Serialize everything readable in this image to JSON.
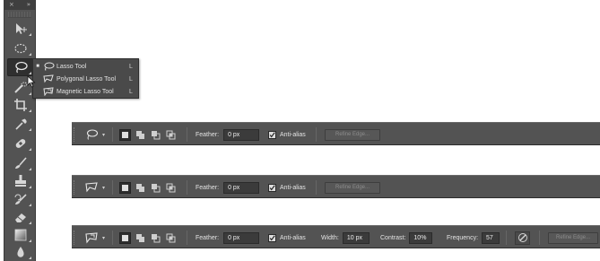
{
  "panel_header": {
    "collapse": "×",
    "expand": "»"
  },
  "flyout": {
    "items": [
      {
        "bullet": "■",
        "label": "Lasso Tool",
        "shortcut": "L",
        "icon": "lasso-icon"
      },
      {
        "bullet": "",
        "label": "Polygonal Lasso Tool",
        "shortcut": "L",
        "icon": "polygonal-lasso-icon"
      },
      {
        "bullet": "",
        "label": "Magnetic Lasso Tool",
        "shortcut": "L",
        "icon": "magnetic-lasso-icon"
      }
    ]
  },
  "tools": [
    "move-tool-icon",
    "elliptical-marquee-icon",
    "lasso-tool-icon",
    "quick-selection-icon",
    "crop-tool-icon",
    "eyedropper-icon",
    "healing-brush-icon",
    "brush-tool-icon",
    "clone-stamp-icon",
    "history-brush-icon",
    "eraser-icon",
    "gradient-icon",
    "blur-tool-icon"
  ],
  "options_bars": [
    {
      "tool_icon": "lasso-icon",
      "feather_label": "Feather:",
      "feather_value": "0 px",
      "antialias_label": "Anti-alias",
      "antialias_checked": true,
      "refine_label": "Refine Edge..."
    },
    {
      "tool_icon": "polygonal-lasso-icon",
      "feather_label": "Feather:",
      "feather_value": "0 px",
      "antialias_label": "Anti-alias",
      "antialias_checked": true,
      "refine_label": "Refine Edge..."
    },
    {
      "tool_icon": "magnetic-lasso-icon",
      "feather_label": "Feather:",
      "feather_value": "0 px",
      "antialias_label": "Anti-alias",
      "antialias_checked": true,
      "width_label": "Width:",
      "width_value": "10 px",
      "contrast_label": "Contrast:",
      "contrast_value": "10%",
      "frequency_label": "Frequency:",
      "frequency_value": "57",
      "refine_label": "Refine Edge..."
    }
  ],
  "colors": {
    "panel_bg": "#535353",
    "panel_dark": "#3f3f3f",
    "field_bg": "#3b3b3b",
    "text": "#e3e3e3",
    "disabled_text": "#8c8c8c",
    "canvas_bg": "#ffffff"
  }
}
